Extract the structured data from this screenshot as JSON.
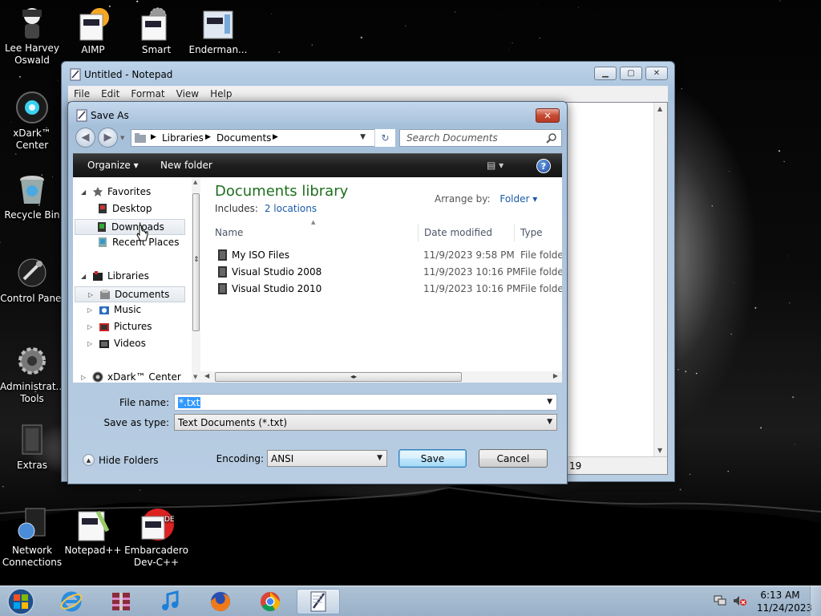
{
  "desktop": {
    "icons": [
      {
        "label": "Lee Harvey Oswald"
      },
      {
        "label": "xDark™ Center"
      },
      {
        "label": "Recycle Bin"
      },
      {
        "label": "Control Panel"
      },
      {
        "label": "Administrat... Tools"
      },
      {
        "label": "Extras"
      },
      {
        "label": "Network Connections"
      },
      {
        "label": "AIMP"
      },
      {
        "label": "Smart"
      },
      {
        "label": "Enderman..."
      },
      {
        "label": "Notepad++"
      },
      {
        "label": "Embarcadero Dev-C++"
      }
    ]
  },
  "notepad": {
    "title": "Untitled - Notepad",
    "menu": [
      "File",
      "Edit",
      "Format",
      "View",
      "Help"
    ],
    "status_text": "19"
  },
  "dialog": {
    "title": "Save As",
    "close_label": "✕",
    "address": {
      "crumbs": [
        "Libraries",
        "Documents"
      ]
    },
    "search_placeholder": "Search Documents",
    "toolbar": {
      "organize": "Organize ▾",
      "new_folder": "New folder",
      "help": "?"
    },
    "nav": {
      "favorites": "Favorites",
      "desktop": "Desktop",
      "downloads": "Downloads",
      "recent": "Recent Places",
      "libraries": "Libraries",
      "documents": "Documents",
      "music": "Music",
      "pictures": "Pictures",
      "videos": "Videos",
      "xdark": "xDark™ Center"
    },
    "content": {
      "library_title": "Documents library",
      "includes_label": "Includes:",
      "includes_link": "2 locations",
      "arrange_label": "Arrange by:",
      "arrange_value": "Folder",
      "columns": [
        "Name",
        "Date modified",
        "Type"
      ],
      "files": [
        {
          "name": "My ISO Files",
          "date": "11/9/2023 9:58 PM",
          "type": "File folder"
        },
        {
          "name": "Visual Studio 2008",
          "date": "11/9/2023 10:16 PM",
          "type": "File folder"
        },
        {
          "name": "Visual Studio 2010",
          "date": "11/9/2023 10:16 PM",
          "type": "File folder"
        }
      ]
    },
    "filename_label": "File name:",
    "filename_value": "*.txt",
    "savetype_label": "Save as type:",
    "savetype_value": "Text Documents (*.txt)",
    "hide_folders": "Hide Folders",
    "encoding_label": "Encoding:",
    "encoding_value": "ANSI",
    "save_button": "Save",
    "cancel_button": "Cancel"
  },
  "taskbar": {
    "apps": [
      "start-orb",
      "internet-explorer-icon",
      "winrar-icon",
      "music-icon",
      "firefox-icon",
      "chrome-icon",
      "notepad-icon"
    ],
    "clock_time": "6:13 AM",
    "clock_date": "11/24/2023"
  }
}
